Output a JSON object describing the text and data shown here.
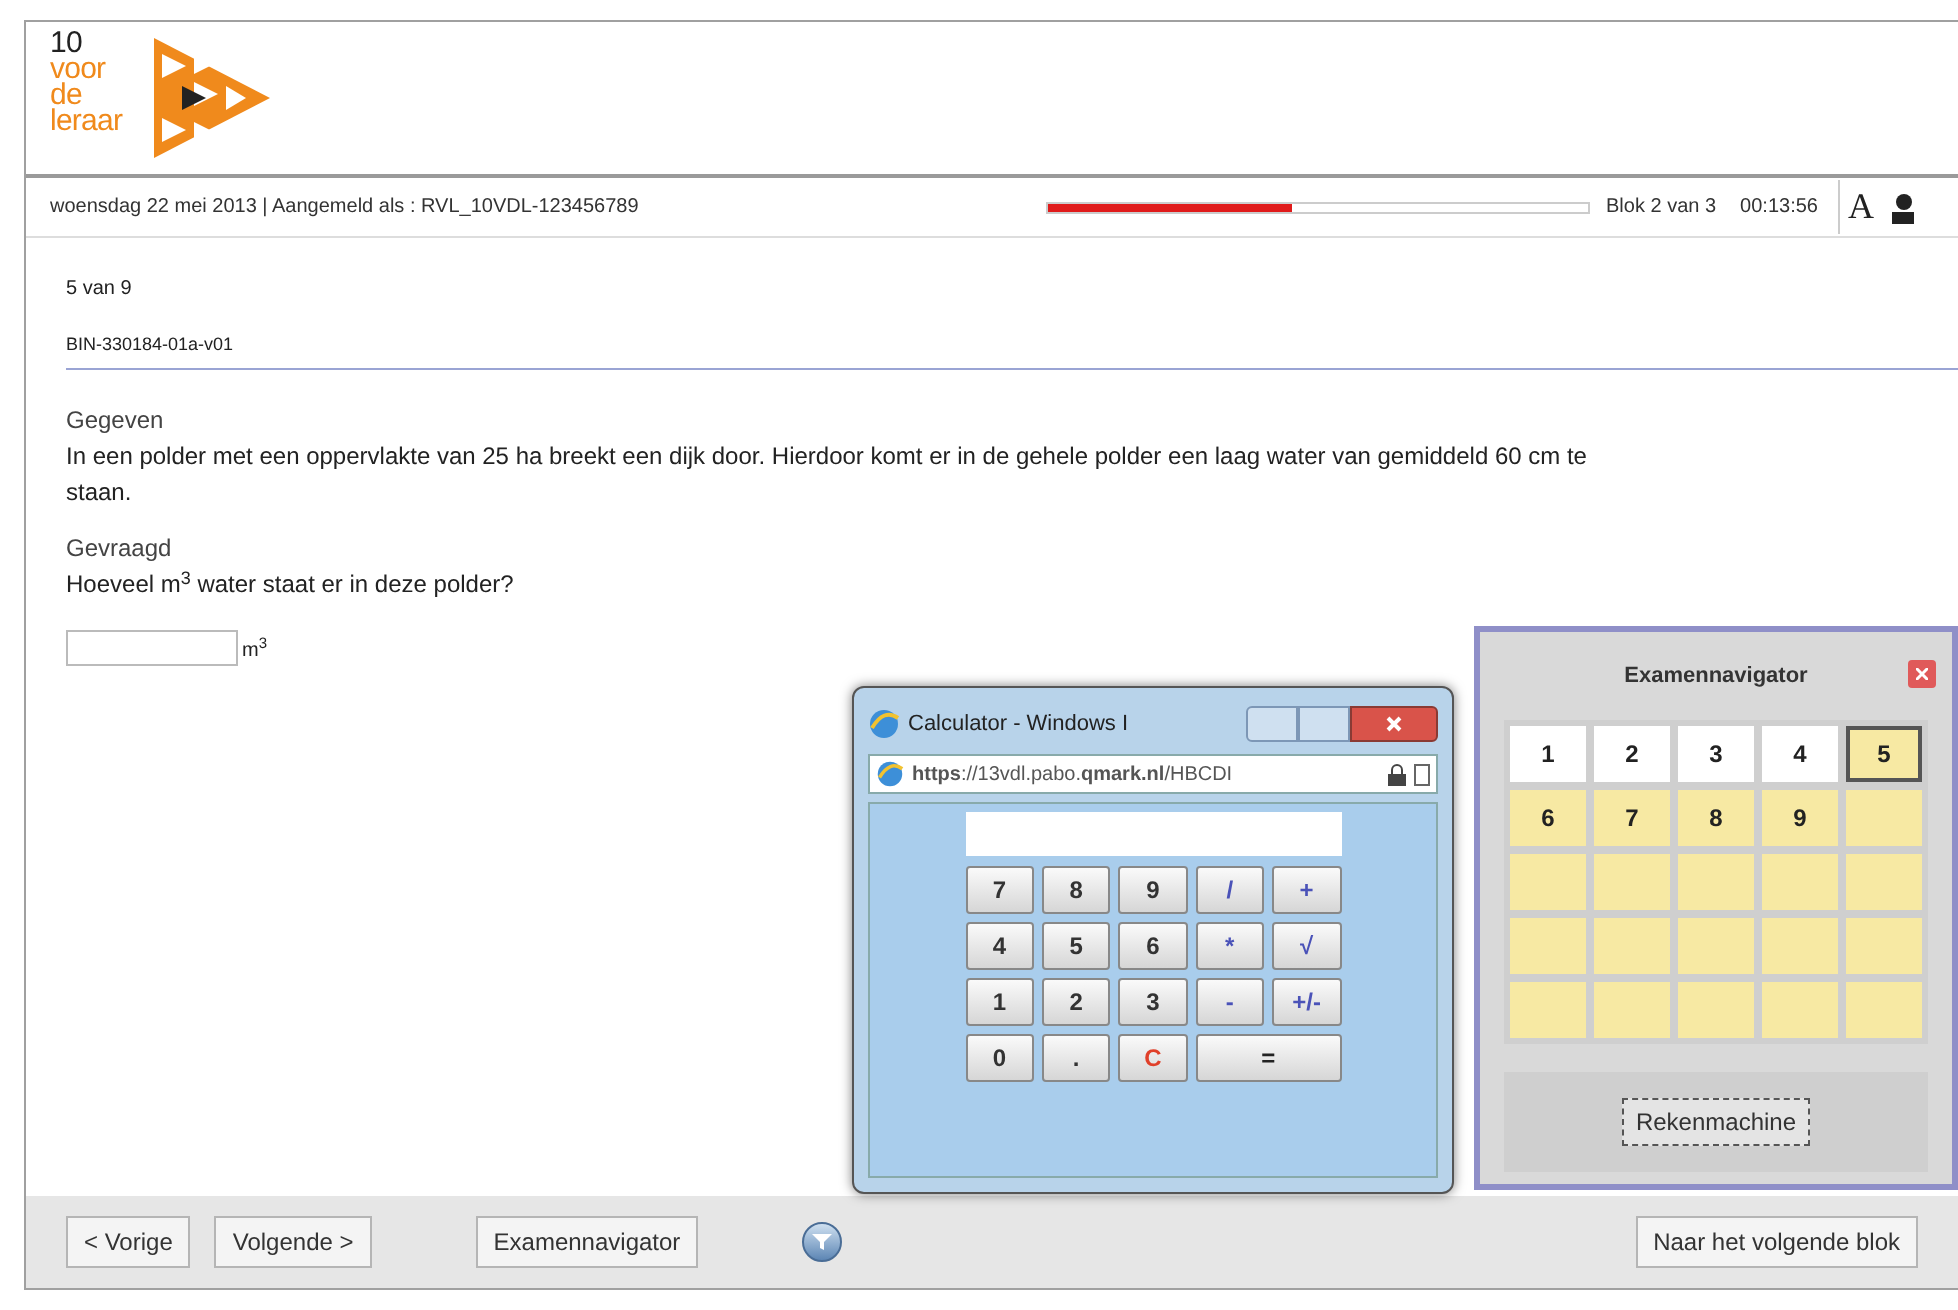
{
  "logo": {
    "lines": [
      {
        "text": "10",
        "kind": "dark"
      },
      {
        "text": "voor",
        "kind": "accent"
      },
      {
        "text": "de",
        "kind": "accent"
      },
      {
        "text": "leraar",
        "kind": "accent"
      }
    ]
  },
  "info_bar": {
    "session": "woensdag 22 mei 2013 | Aangemeld als : RVL_10VDL-123456789",
    "progress": {
      "level": 0.45
    },
    "block": "Blok 2 van 3",
    "timer": "00:13:56",
    "font_button": "A"
  },
  "question": {
    "counter": "5 van 9",
    "code": "BIN-330184-01a-v01",
    "given_label": "Gegeven",
    "given_text": "In een polder met een oppervlakte van 25 ha breekt een dijk door. Hierdoor komt er in de gehele polder een laag water van gemiddeld 60 cm te",
    "given_text_cont": "staan.",
    "asked_label": "Gevraagd",
    "asked_text": "Hoeveel m$^{3}$ water staat er in deze polder?",
    "answer": {
      "unit": "m$^{3}$"
    }
  },
  "calculator": {
    "title": "Calculator - Windows I",
    "url": "**https**://13vdl.pabo.**qmark.nl**/HBCDI",
    "keys": [
      {
        "label": "7",
        "kind": "digit"
      },
      {
        "label": "8",
        "kind": "digit"
      },
      {
        "label": "9",
        "kind": "digit"
      },
      {
        "label": "/",
        "kind": "op"
      },
      {
        "label": "+",
        "kind": "op"
      },
      {
        "label": "4",
        "kind": "digit"
      },
      {
        "label": "5",
        "kind": "digit"
      },
      {
        "label": "6",
        "kind": "digit"
      },
      {
        "label": "*",
        "kind": "op"
      },
      {
        "label": "√",
        "kind": "op"
      },
      {
        "label": "1",
        "kind": "digit"
      },
      {
        "label": "2",
        "kind": "digit"
      },
      {
        "label": "3",
        "kind": "digit"
      },
      {
        "label": "-",
        "kind": "op"
      },
      {
        "label": "+/-",
        "kind": "op"
      },
      {
        "label": "0",
        "kind": "digit"
      },
      {
        "label": ".",
        "kind": "digit"
      },
      {
        "label": "C",
        "kind": "clear"
      },
      {
        "label": "=",
        "kind": "equals"
      }
    ]
  },
  "navigator": {
    "title": "Examennavigator",
    "cells": [
      {
        "label": "1",
        "answered": true,
        "selected": false
      },
      {
        "label": "2",
        "answered": true,
        "selected": false
      },
      {
        "label": "3",
        "answered": true,
        "selected": false
      },
      {
        "label": "4",
        "answered": true,
        "selected": false
      },
      {
        "label": "5",
        "answered": false,
        "selected": true
      },
      {
        "label": "6",
        "answered": false,
        "selected": false
      },
      {
        "label": "7",
        "answered": false,
        "selected": false
      },
      {
        "label": "8",
        "answered": false,
        "selected": false
      },
      {
        "label": "9",
        "answered": false,
        "selected": false
      },
      {
        "answered": false,
        "selected": false
      },
      {
        "answered": false,
        "selected": false
      },
      {
        "answered": false,
        "selected": false
      },
      {
        "answered": false,
        "selected": false
      },
      {
        "answered": false,
        "selected": false
      },
      {
        "answered": false,
        "selected": false
      },
      {
        "answered": false,
        "selected": false
      },
      {
        "answered": false,
        "selected": false
      },
      {
        "answered": false,
        "selected": false
      },
      {
        "answered": false,
        "selected": false
      },
      {
        "answered": false,
        "selected": false
      },
      {
        "answered": false,
        "selected": false
      },
      {
        "answered": false,
        "selected": false
      },
      {
        "answered": false,
        "selected": false
      },
      {
        "answered": false,
        "selected": false
      },
      {
        "answered": false,
        "selected": false
      }
    ],
    "button": "Rekenmachine"
  },
  "footer": {
    "prev": "< Vorige",
    "next": "Volgende >",
    "navigator": "Examennavigator",
    "next_block": "Naar het volgende blok"
  }
}
